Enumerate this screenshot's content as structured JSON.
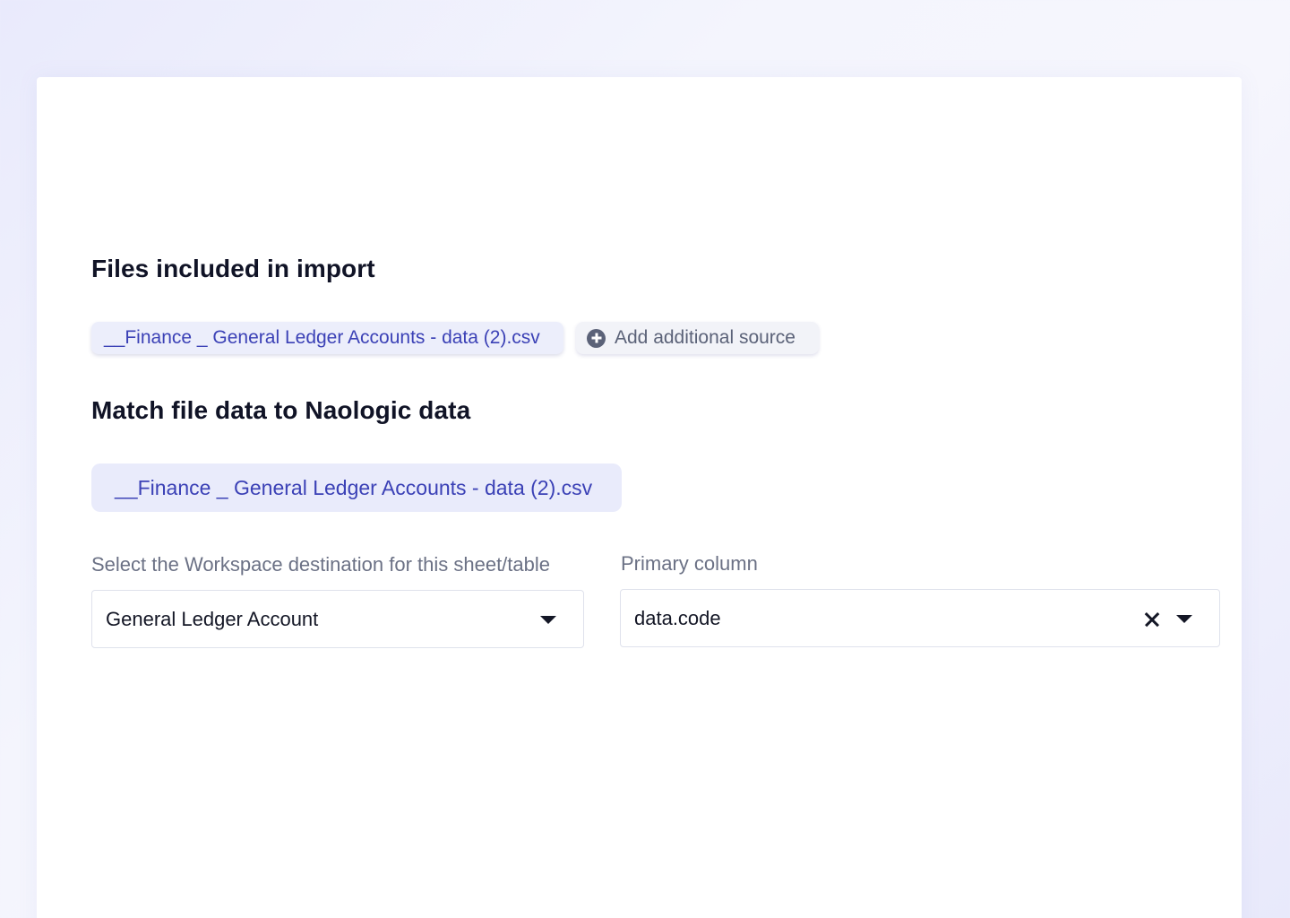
{
  "files_section": {
    "title": "Files included in import",
    "file_chip": "__Finance _ General Ledger Accounts - data (2).csv",
    "add_source_label": "Add additional source"
  },
  "match_section": {
    "title": "Match file data to Naologic data",
    "file_tab": "__Finance _ General Ledger Accounts - data (2).csv",
    "destination": {
      "label": "Select the Workspace destination for this sheet/table",
      "value": "General Ledger Account"
    },
    "primary_column": {
      "label": "Primary column",
      "value": "data.code"
    }
  },
  "colors": {
    "accent_text": "#3b41b6",
    "chip_bg": "#eceefb",
    "heading": "#101326",
    "muted": "#6b7185"
  },
  "icons": {
    "add_source": "plus-circle-icon",
    "dropdown": "chevron-down-icon",
    "clear": "close-icon"
  }
}
